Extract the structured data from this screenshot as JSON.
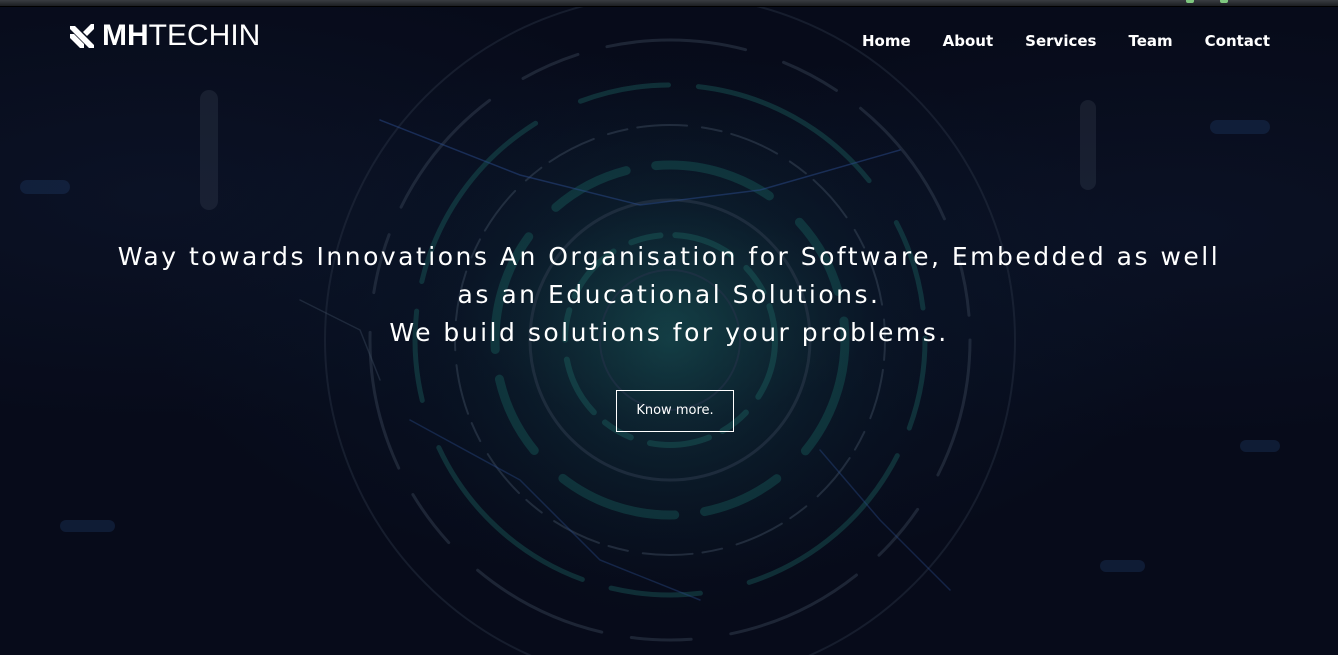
{
  "brand": {
    "logo_bold": "MH",
    "logo_thin": "TECHIN"
  },
  "nav": {
    "items": [
      {
        "label": "Home"
      },
      {
        "label": "About"
      },
      {
        "label": "Services"
      },
      {
        "label": "Team"
      },
      {
        "label": "Contact"
      }
    ]
  },
  "hero": {
    "line1": "Way towards Innovations An Organisation for Software, Embedded as well",
    "line2": "as an Educational Solutions.",
    "line3": "We build solutions for your problems.",
    "button_label": "Know more."
  },
  "colors": {
    "background": "#070b1a",
    "text": "#ffffff",
    "accent_teal": "#1f6f6a",
    "accent_blue": "#2a4a8a"
  }
}
